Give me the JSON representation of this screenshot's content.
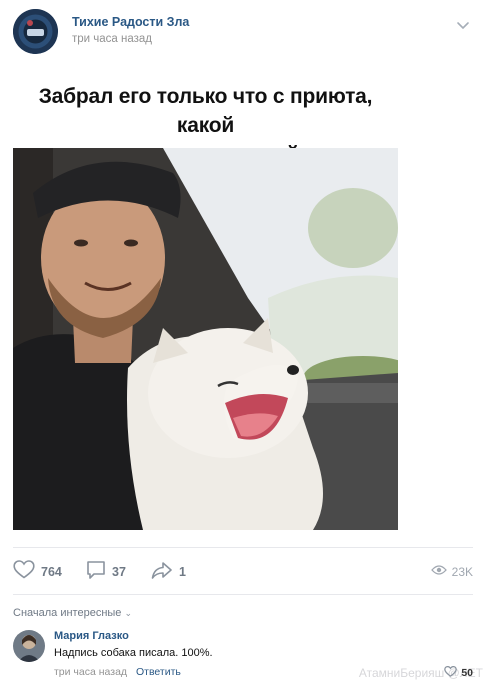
{
  "post": {
    "group_name": "Тихие Радости Зла",
    "time": "три часа назад",
    "caption_line1": "Забрал его только что с приюта, какой",
    "caption_line2": "же он счастливый"
  },
  "actions": {
    "likes": "764",
    "comments": "37",
    "shares": "1",
    "views": "23K"
  },
  "comments": {
    "sort_label": "Сначала интересные",
    "items": [
      {
        "author": "Мария Глазко",
        "text": "Надпись собака писала. 100%.",
        "time": "три часа назад",
        "reply_label": "Ответить",
        "likes": "50"
      }
    ]
  },
  "watermark": "АтамниБерияш @ЛЕТ",
  "icons": {
    "menu": "chevron-down-icon",
    "like": "heart-icon",
    "comment": "comment-icon",
    "share": "share-arrow-icon",
    "views": "eye-icon"
  },
  "colors": {
    "link": "#2a5885",
    "meta": "#939393",
    "icon": "#8a939e"
  }
}
